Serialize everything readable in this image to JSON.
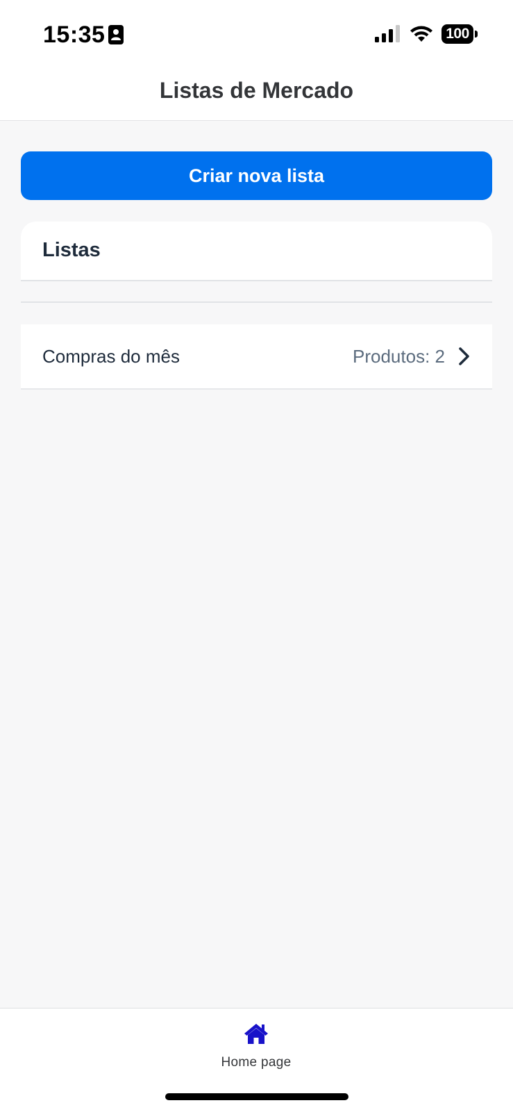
{
  "status_bar": {
    "time": "15:35",
    "battery": "100",
    "icons": [
      "contact-card-icon",
      "cellular-signal-icon",
      "wifi-icon",
      "battery-icon"
    ]
  },
  "header": {
    "title": "Listas de Mercado"
  },
  "main": {
    "create_button_label": "Criar nova lista",
    "lists_heading": "Listas",
    "lists": [
      {
        "name": "Compras do mês",
        "count_label": "Produtos: 2",
        "icon": "chevron-right-icon"
      }
    ]
  },
  "tab_bar": {
    "tabs": [
      {
        "label": "Home page",
        "icon": "home-icon",
        "active": true
      }
    ]
  },
  "colors": {
    "primary": "#0071ee",
    "active_tab_icon": "#1812c9",
    "background": "#f7f7f8",
    "text_dark": "#1e2b3b",
    "text_muted": "#5b6b7d"
  }
}
